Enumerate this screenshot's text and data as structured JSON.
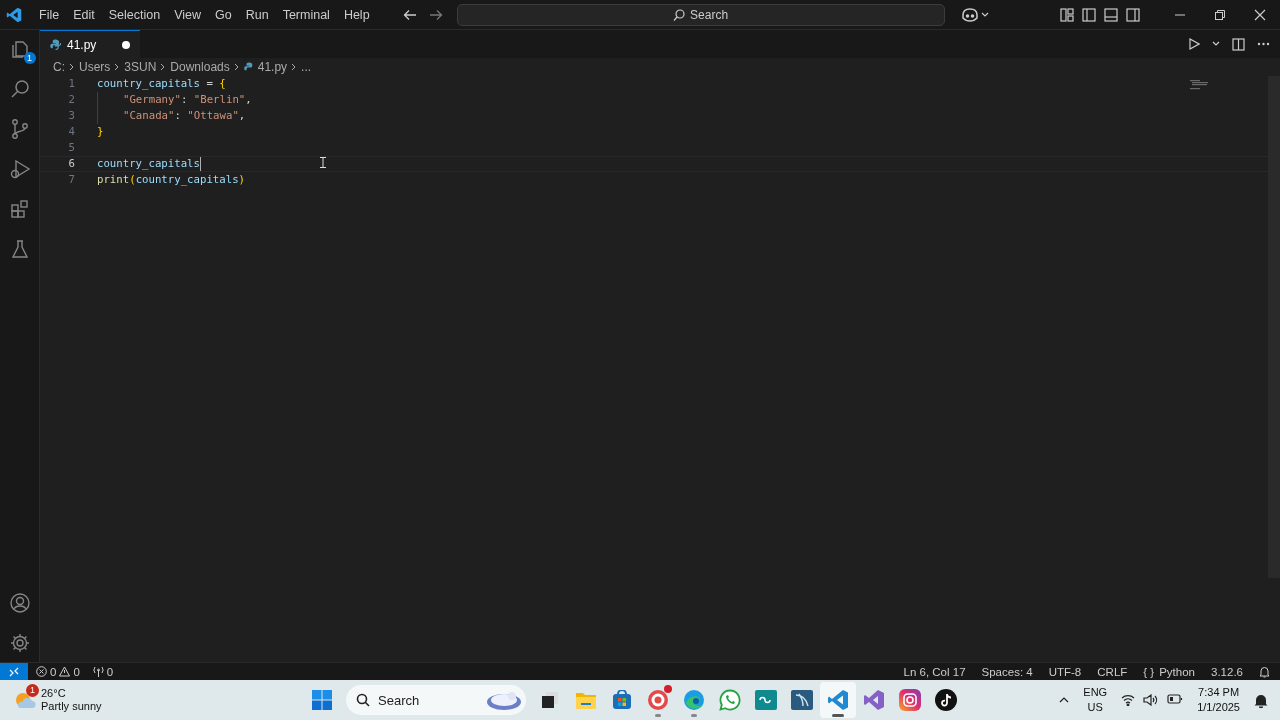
{
  "menu": [
    "File",
    "Edit",
    "Selection",
    "View",
    "Go",
    "Run",
    "Terminal",
    "Help"
  ],
  "command_center": {
    "placeholder": "Search"
  },
  "tab": {
    "label": "41.py",
    "modified": true
  },
  "breadcrumbs": [
    "C:",
    "Users",
    "3SUN",
    "Downloads",
    "41.py",
    "..."
  ],
  "activity_bar": {
    "explorer_badge": "1"
  },
  "lines": [
    {
      "number": "1",
      "current": false,
      "tokens": [
        {
          "kind": "variable",
          "text": "country_capitals"
        },
        {
          "kind": "plain",
          "text": " = "
        },
        {
          "kind": "bracket",
          "text": "{"
        }
      ]
    },
    {
      "number": "2",
      "current": false,
      "indented": true,
      "tokens": [
        {
          "kind": "string",
          "text": "\"Germany\""
        },
        {
          "kind": "plain",
          "text": ": "
        },
        {
          "kind": "string",
          "text": "\"Berlin\""
        },
        {
          "kind": "plain",
          "text": ","
        }
      ]
    },
    {
      "number": "3",
      "current": false,
      "indented": true,
      "tokens": [
        {
          "kind": "string",
          "text": "\"Canada\""
        },
        {
          "kind": "plain",
          "text": ": "
        },
        {
          "kind": "string",
          "text": "\"Ottawa\""
        },
        {
          "kind": "plain",
          "text": ","
        }
      ]
    },
    {
      "number": "4",
      "current": false,
      "tokens": [
        {
          "kind": "bracket",
          "text": "}"
        }
      ]
    },
    {
      "number": "5",
      "current": false
    },
    {
      "number": "6",
      "current": true,
      "tokens": [
        {
          "kind": "variable",
          "text": "country_capitals"
        }
      ]
    },
    {
      "number": "7",
      "current": false,
      "tokens": [
        {
          "kind": "function",
          "text": "print"
        },
        {
          "kind": "bracket",
          "text": "("
        },
        {
          "kind": "variable",
          "text": "country_capitals"
        },
        {
          "kind": "bracket",
          "text": ")"
        }
      ]
    }
  ],
  "status_bar": {
    "errors": "0",
    "warnings": "0",
    "ports": "0",
    "items": [
      {
        "text": "Ln 6, Col 17"
      },
      {
        "text": "Spaces: 4"
      },
      {
        "text": "UTF-8"
      },
      {
        "text": "CRLF"
      },
      {
        "icon": "{ }",
        "text": "Python"
      },
      {
        "text": "3.12.6"
      }
    ]
  },
  "taskbar": {
    "weather": {
      "temperature": "26°C",
      "condition": "Partly sunny",
      "badge": "1"
    },
    "search": {
      "placeholder": "Search"
    },
    "apps": [
      {
        "kind": "windows",
        "running": false,
        "active": false
      },
      {
        "kind": "search"
      },
      {
        "kind": "task-view",
        "running": false,
        "active": false
      },
      {
        "kind": "folder",
        "running": false,
        "active": false
      },
      {
        "kind": "store",
        "running": false,
        "active": false
      },
      {
        "kind": "target",
        "running": true,
        "active": false
      },
      {
        "kind": "browser",
        "running": true,
        "active": false
      },
      {
        "kind": "chat",
        "running": false,
        "active": false
      },
      {
        "kind": "infinity",
        "running": false,
        "active": false
      },
      {
        "kind": "dolphin",
        "running": false,
        "active": false
      },
      {
        "kind": "code",
        "running": true,
        "active": true
      },
      {
        "kind": "studio",
        "running": false,
        "active": false
      },
      {
        "kind": "camera",
        "running": false,
        "active": false
      },
      {
        "kind": "note",
        "running": false,
        "active": false
      }
    ],
    "language": {
      "line_1": "ENG",
      "line_2": "US"
    },
    "time": "7:34 PM",
    "date": "1/1/2025"
  }
}
